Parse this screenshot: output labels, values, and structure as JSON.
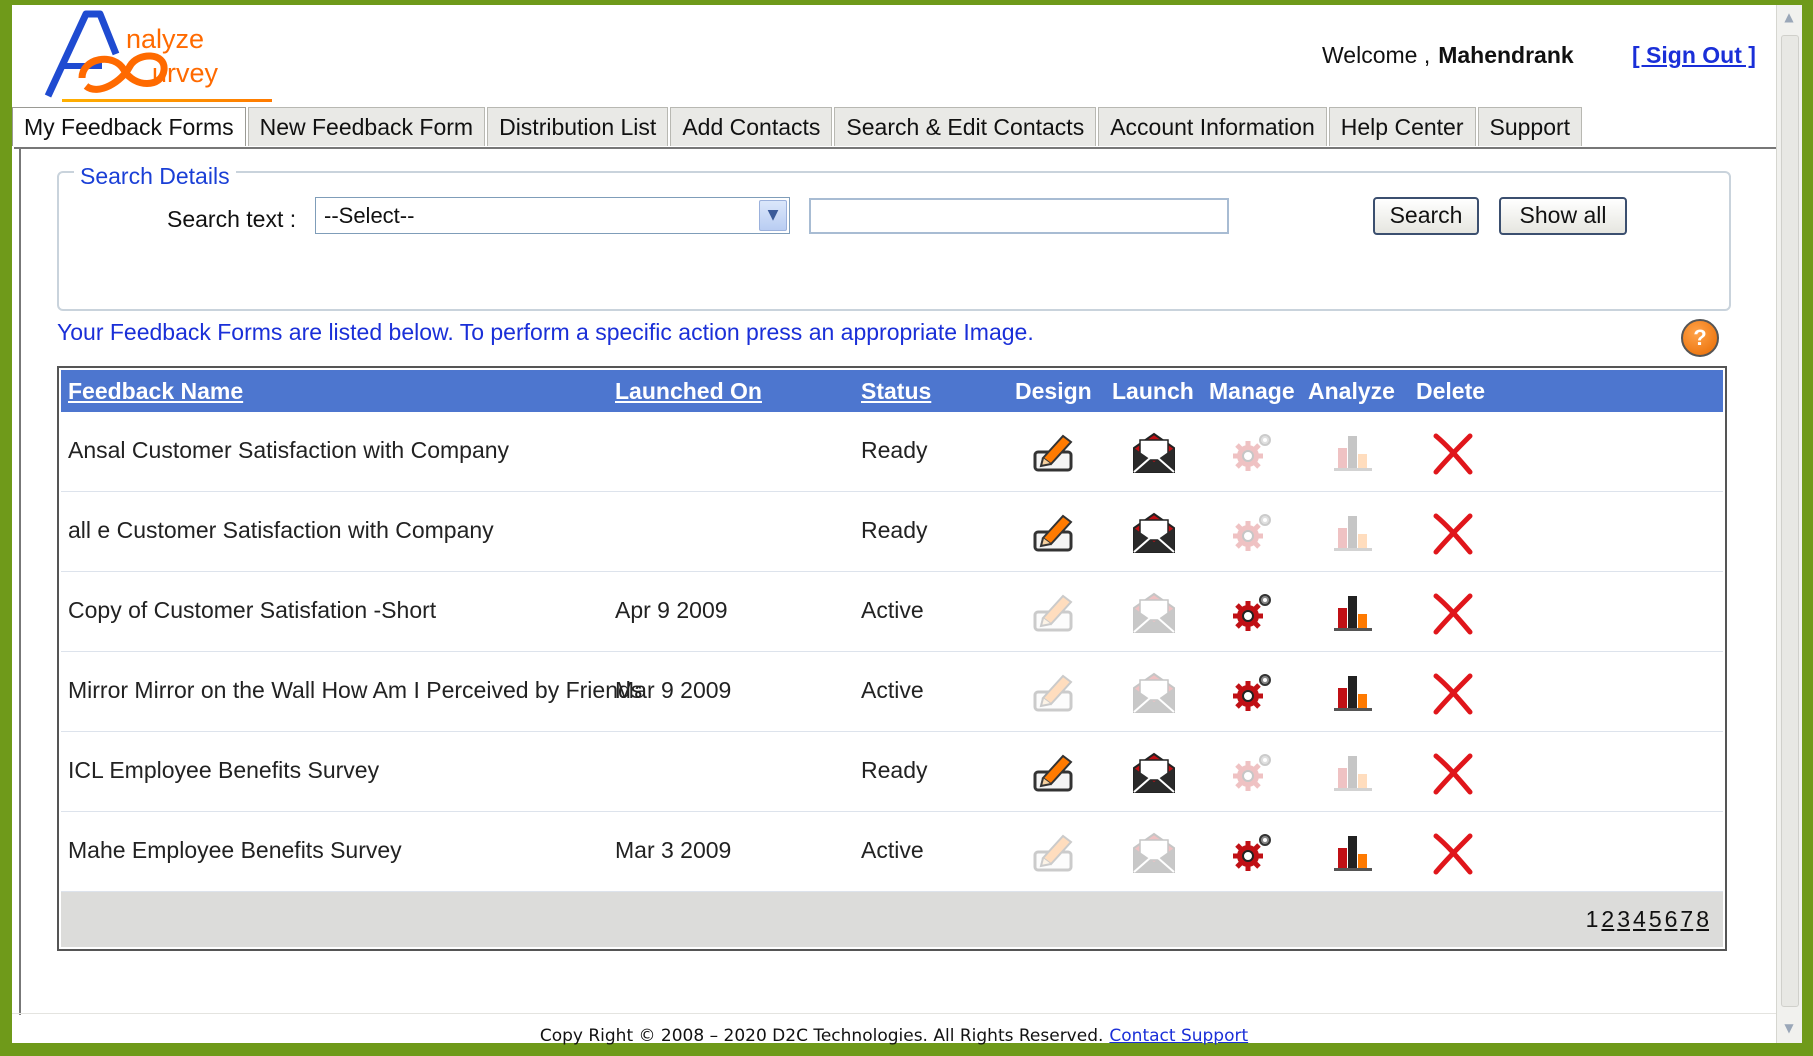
{
  "header": {
    "logo_letters": "A S",
    "logo_word1": "nalyze",
    "logo_word2": "urvey",
    "welcome_label": "Welcome ,",
    "username": "Mahendrank",
    "signout_label": "[ Sign Out ]"
  },
  "tabs": [
    {
      "label": "My Feedback Forms",
      "active": true
    },
    {
      "label": "New Feedback Form"
    },
    {
      "label": "Distribution List"
    },
    {
      "label": "Add Contacts"
    },
    {
      "label": "Search & Edit Contacts"
    },
    {
      "label": "Account Information"
    },
    {
      "label": "Help Center"
    },
    {
      "label": "Support"
    }
  ],
  "search": {
    "legend": "Search Details",
    "label": "Search text :",
    "select_value": "--Select--",
    "input_value": "",
    "search_button": "Search",
    "show_all_button": "Show all"
  },
  "info_text": "Your Feedback Forms are listed below. To perform a specific action press an appropriate Image.",
  "help_icon_glyph": "?",
  "table": {
    "headers": {
      "name": "Feedback Name",
      "launched": "Launched On",
      "status": "Status",
      "design": "Design",
      "launch": "Launch",
      "manage": "Manage",
      "analyze": "Analyze",
      "delete": "Delete"
    },
    "rows": [
      {
        "name": "Ansal Customer Satisfaction with Company",
        "launched": "",
        "status": "Ready"
      },
      {
        "name": "all e Customer Satisfaction with Company",
        "launched": "",
        "status": "Ready"
      },
      {
        "name": "Copy of Customer Satisfation -Short",
        "launched": "Apr 9 2009",
        "status": "Active"
      },
      {
        "name": "Mirror Mirror on the Wall How Am I Perceived by Friends",
        "launched": "Mar 9 2009",
        "status": "Active"
      },
      {
        "name": "ICL Employee Benefits Survey",
        "launched": "",
        "status": "Ready"
      },
      {
        "name": "Mahe Employee Benefits Survey",
        "launched": "Mar 3 2009",
        "status": "Active"
      }
    ],
    "pages": [
      "1",
      "2",
      "3",
      "4",
      "5",
      "6",
      "7",
      "8"
    ]
  },
  "icons": {
    "design": "pencil-edit-icon",
    "launch": "envelope-launch-icon",
    "manage": "gears-icon",
    "analyze": "bar-chart-icon",
    "delete": "red-x-delete-icon"
  },
  "colors": {
    "tab_header_blue": "#4d76cf",
    "link_blue": "#1a2fd8",
    "logo_blue": "#1f4bd1",
    "logo_orange": "#ff6a00",
    "delete_red": "#e0161b",
    "active_red": "#c01015"
  },
  "footer": {
    "copyright": "Copy Right © 2008 – 2020 D2C Technologies. All Rights Reserved.",
    "contact_link": "Contact Support"
  }
}
